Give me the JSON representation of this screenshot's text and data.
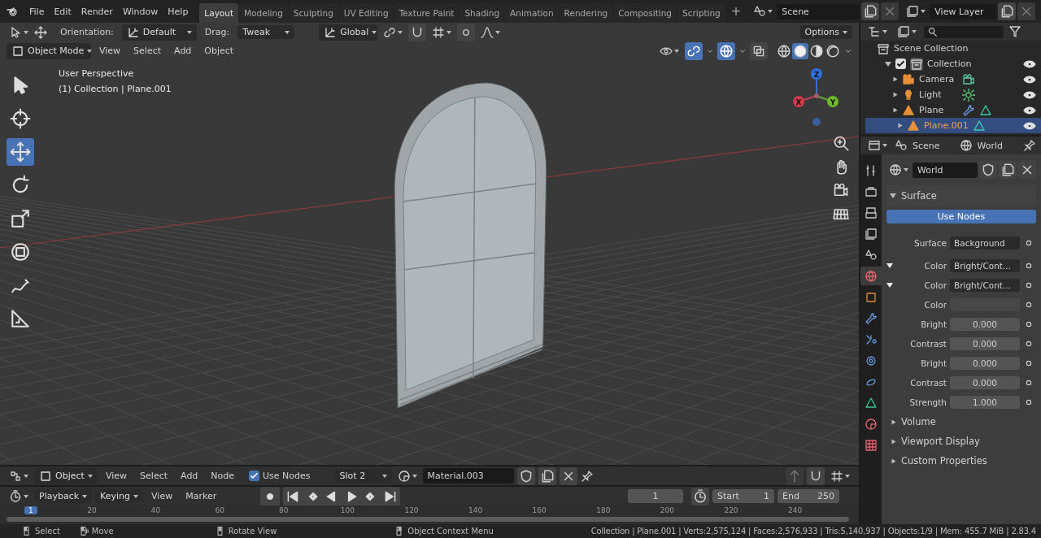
{
  "menu": [
    "File",
    "Edit",
    "Render",
    "Window",
    "Help"
  ],
  "workspaces": [
    {
      "label": "Layout",
      "selected": true
    },
    {
      "label": "Modeling",
      "selected": false
    },
    {
      "label": "Sculpting",
      "selected": false
    },
    {
      "label": "UV Editing",
      "selected": false
    },
    {
      "label": "Texture Paint",
      "selected": false
    },
    {
      "label": "Shading",
      "selected": false
    },
    {
      "label": "Animation",
      "selected": false
    },
    {
      "label": "Rendering",
      "selected": false
    },
    {
      "label": "Compositing",
      "selected": false
    },
    {
      "label": "Scripting",
      "selected": false
    }
  ],
  "add_workspace": "+",
  "scene": "Scene",
  "view_layer": "View Layer",
  "tool_header": {
    "orientation_label": "Orientation:",
    "orientation": "Default",
    "drag_label": "Drag:",
    "drag": "Tweak",
    "transform": "Global",
    "options": "Options"
  },
  "viewport_header": {
    "mode": "Object Mode",
    "menu": [
      "View",
      "Select",
      "Add",
      "Object"
    ],
    "toggles": [
      {
        "kind": "gizmos",
        "on": true
      },
      {
        "kind": "overlays",
        "on": true
      },
      {
        "kind": "xray",
        "on": false
      }
    ],
    "shading": [
      {
        "kind": "wireframe",
        "selected": false
      },
      {
        "kind": "solid",
        "selected": true
      },
      {
        "kind": "material",
        "selected": false
      },
      {
        "kind": "rendered",
        "selected": false
      }
    ]
  },
  "viewport": {
    "view_name": "User Perspective",
    "object_info": "(1) Collection | Plane.001",
    "gizmo_axes": [
      "X",
      "Y",
      "Z"
    ],
    "tools": [
      {
        "kind": "select",
        "selected": false
      },
      {
        "kind": "cursor",
        "selected": false
      },
      {
        "kind": "move",
        "selected": true
      },
      {
        "kind": "rotate",
        "selected": false
      },
      {
        "kind": "scale",
        "selected": false
      },
      {
        "kind": "transform",
        "selected": false
      },
      {
        "kind": "annotate",
        "selected": false
      },
      {
        "kind": "measure",
        "selected": false
      }
    ]
  },
  "outliner": {
    "root": "Scene Collection",
    "collections": [
      {
        "label": "Collection",
        "expanded": true,
        "checked": true,
        "children": [
          {
            "label": "Camera",
            "kind": "camera",
            "selected": false,
            "expanded": false,
            "extras": [
              {
                "kind": "camera_data"
              }
            ]
          },
          {
            "label": "Light",
            "kind": "light",
            "selected": false,
            "expanded": false,
            "extras": [
              {
                "kind": "light_data"
              }
            ]
          },
          {
            "label": "Plane",
            "kind": "mesh",
            "selected": false,
            "expanded": false,
            "extras": [
              {
                "kind": "modifier"
              },
              {
                "kind": "mesh_data"
              }
            ]
          },
          {
            "label": "Plane.001",
            "kind": "mesh",
            "selected": true,
            "expanded": false,
            "extras": [
              {
                "kind": "mesh_data"
              }
            ]
          }
        ]
      }
    ]
  },
  "properties": {
    "breadcrumb": [
      "Scene",
      "World"
    ],
    "tabs": [
      {
        "kind": "tool",
        "selected": false
      },
      {
        "kind": "render",
        "selected": false
      },
      {
        "kind": "output",
        "selected": false
      },
      {
        "kind": "view_layer",
        "selected": false
      },
      {
        "kind": "scene",
        "selected": false
      },
      {
        "kind": "world",
        "selected": true
      },
      {
        "kind": "object",
        "selected": false
      },
      {
        "kind": "modifier",
        "selected": false
      },
      {
        "kind": "particles",
        "selected": false
      },
      {
        "kind": "physics",
        "selected": false
      },
      {
        "kind": "constraints",
        "selected": false
      },
      {
        "kind": "data",
        "selected": false
      },
      {
        "kind": "material",
        "selected": false
      },
      {
        "kind": "texture",
        "selected": false
      }
    ],
    "world": "World",
    "surface_panel": {
      "title": "Surface",
      "expanded": true
    },
    "use_nodes": "Use Nodes",
    "rows": [
      {
        "kind": "link",
        "label": "Surface",
        "value": "Background"
      },
      {
        "kind": "node",
        "label": "Color",
        "value": "Bright/Cont...",
        "expanded": true
      },
      {
        "kind": "node",
        "label": "Color",
        "value": "Bright/Cont...",
        "expanded": true
      },
      {
        "kind": "color",
        "label": "Color"
      },
      {
        "kind": "number",
        "label": "Bright",
        "value": "0.000"
      },
      {
        "kind": "number",
        "label": "Contrast",
        "value": "0.000"
      },
      {
        "kind": "number",
        "label": "Bright",
        "value": "0.000"
      },
      {
        "kind": "number",
        "label": "Contrast",
        "value": "0.000"
      },
      {
        "kind": "number",
        "label": "Strength",
        "value": "1.000"
      }
    ],
    "panels": [
      {
        "title": "Volume",
        "expanded": false
      },
      {
        "title": "Viewport Display",
        "expanded": false
      },
      {
        "title": "Custom Properties",
        "expanded": false
      }
    ]
  },
  "shader_header": {
    "mode": "Object",
    "menu": [
      "View",
      "Select",
      "Add",
      "Node"
    ],
    "use_nodes": {
      "label": "Use Nodes",
      "checked": true
    },
    "slot": "Slot 2",
    "material": "Material.003"
  },
  "timeline": {
    "menu": [
      "Playback",
      "Keying"
    ],
    "plain_menu": [
      "View",
      "Marker"
    ],
    "current_frame": "1",
    "start_label": "Start",
    "start": "1",
    "end_label": "End",
    "end": "250",
    "frame_badge": "1",
    "ruler": [
      "20",
      "40",
      "60",
      "80",
      "100",
      "120",
      "140",
      "160",
      "180",
      "200",
      "220",
      "240"
    ]
  },
  "status": {
    "hints": [
      {
        "kind": "left",
        "label": "Select"
      },
      {
        "kind": "drag",
        "label": "Move"
      },
      {
        "kind": "middle",
        "label": "Rotate View"
      },
      {
        "kind": "right",
        "label": "Object Context Menu"
      }
    ],
    "stats": "Collection | Plane.001 | Verts:2,575,124 | Faces:2,576,933 | Tris:5,140,937 | Objects:1/9 | Mem: 455.7 MiB | 2.83.4"
  }
}
